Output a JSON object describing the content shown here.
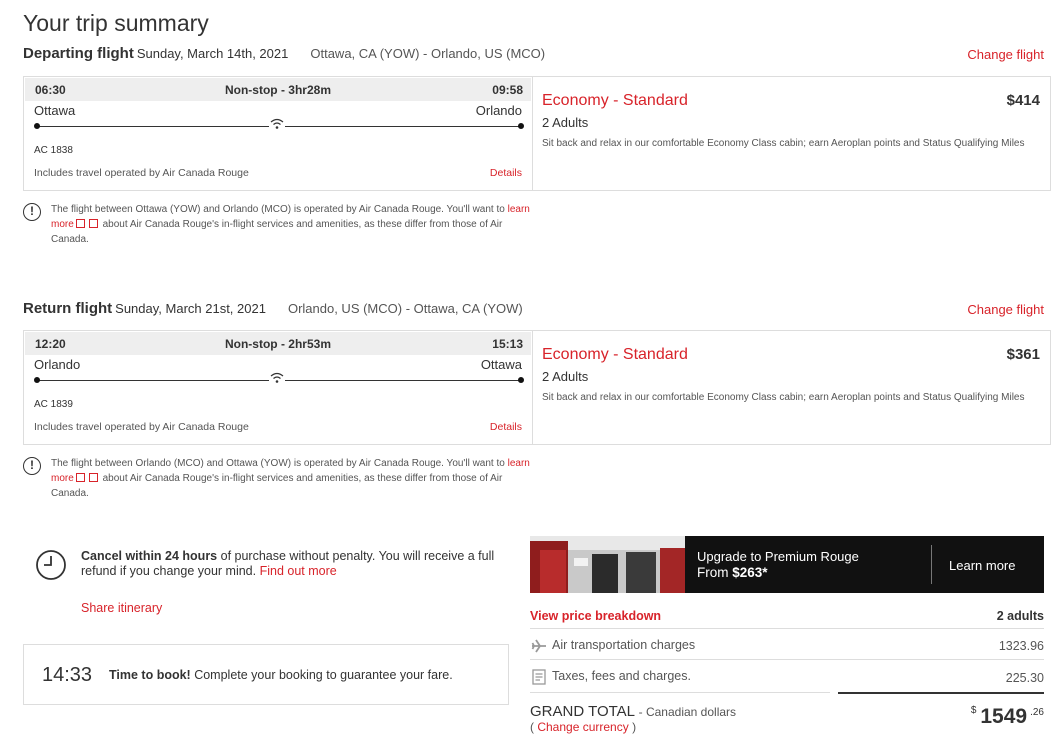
{
  "page": {
    "title": "Your trip summary"
  },
  "departing": {
    "heading": "Departing flight",
    "date": "Sunday, March 14th, 2021",
    "route": "Ottawa, CA (YOW) - Orlando, US (MCO)",
    "change_label": "Change flight",
    "depart_time": "06:30",
    "duration": "Non-stop - 3hr28m",
    "arrive_time": "09:58",
    "origin": "Ottawa",
    "destination": "Orlando",
    "flight_number": "AC 1838",
    "operated_by": "Includes travel operated by Air Canada Rouge",
    "details_label": "Details",
    "cabin": "Economy - Standard",
    "price": "$414",
    "passengers": "2 Adults",
    "cabin_desc": "Sit back and relax in our comfortable Economy Class cabin; earn Aeroplan points and Status Qualifying Miles",
    "notice_a": "The flight between Ottawa (YOW) and Orlando (MCO) is operated by Air Canada Rouge. You'll want to",
    "notice_link": "learn more",
    "notice_b": "about Air Canada Rouge's in-flight services and amenities, as these differ from those of Air Canada."
  },
  "return": {
    "heading": "Return flight",
    "date": "Sunday, March 21st, 2021",
    "route": "Orlando, US (MCO) - Ottawa, CA (YOW)",
    "change_label": "Change flight",
    "depart_time": "12:20",
    "duration": "Non-stop - 2hr53m",
    "arrive_time": "15:13",
    "origin": "Orlando",
    "destination": "Ottawa",
    "flight_number": "AC 1839",
    "operated_by": "Includes travel operated by Air Canada Rouge",
    "details_label": "Details",
    "cabin": "Economy - Standard",
    "price": "$361",
    "passengers": "2 Adults",
    "cabin_desc": "Sit back and relax in our comfortable Economy Class cabin; earn Aeroplan points and Status Qualifying Miles",
    "notice_a": "The flight between Orlando (MCO) and Ottawa (YOW) is operated by Air Canada Rouge. You'll want to",
    "notice_link": "learn more",
    "notice_b": "about Air Canada Rouge's in-flight services and amenities, as these differ from those of Air Canada."
  },
  "cancel": {
    "bold": "Cancel within 24 hours",
    "text": "of purchase without penalty. You will receive a full refund if you change your mind.",
    "link": "Find out more",
    "share": "Share itinerary"
  },
  "timer": {
    "clock": "14:33",
    "bold": "Time to book!",
    "text": "Complete your booking to guarantee your fare."
  },
  "upgrade": {
    "line1": "Upgrade to Premium Rouge",
    "from": "From",
    "price": "$263*",
    "learn_more": "Learn more"
  },
  "pricing": {
    "breakdown_label": "View price breakdown",
    "adults": "2 adults",
    "air_label": "Air transportation charges",
    "air_value": "1323.96",
    "taxes_label": "Taxes, fees and charges.",
    "taxes_value": "225.30",
    "grand_total": "GRAND TOTAL",
    "currency_note": "- Canadian dollars",
    "change_currency": "Change currency",
    "currency_symbol": "$",
    "total_dollars": "1549",
    "total_cents": ".26"
  },
  "colors": {
    "accent": "#d8232a",
    "upgrade_bg": "#111111"
  }
}
